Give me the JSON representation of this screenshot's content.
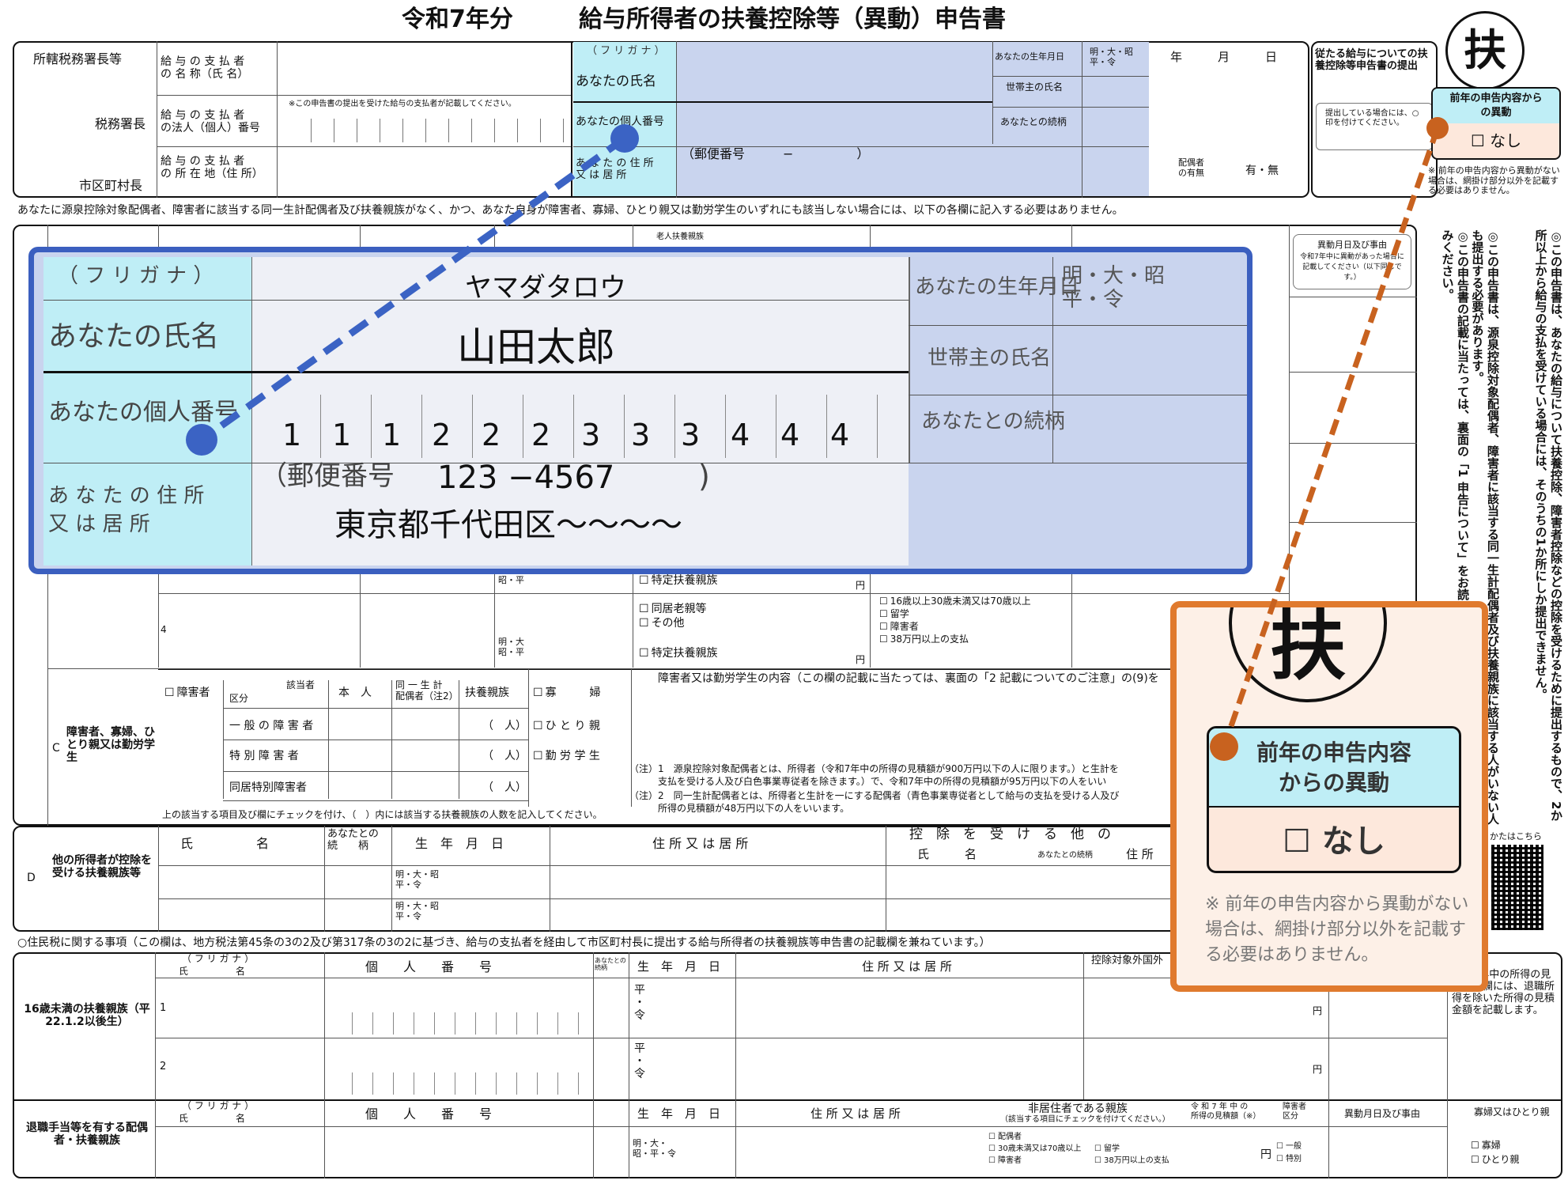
{
  "header": {
    "year": "令和7年分",
    "title": "給与所得者の扶養控除等（異動）申告書",
    "fu_badge": "扶"
  },
  "top": {
    "office_label1": "所轄税務署長等",
    "office_label2": "税務署長",
    "office_label3": "市区町村長",
    "payer_name": "給 与 の 支 払 者\nの 名 称（氏 名）",
    "payer_number": "給 与 の 支 払 者\nの法人（個人）番号",
    "payer_number_note": "※この申告書の提出を受けた給与の支払者が記載してください。",
    "payer_address": "給 与 の 支 払 者\nの 所 在 地（住 所）",
    "furigana_small": "（ フ リ ガ ナ ）",
    "name_small": "あなたの氏名",
    "mynumber_small": "あなたの個人番号",
    "address_small": "あ な た の 住 所\n又 は 居 所",
    "postal_small": "（郵便番号　　　−　　　　　）",
    "birth_small": "あなたの生年月日",
    "era_small": "明・大・昭\n平・令",
    "ymd": "年　　　月　　　日",
    "head_small": "世帯主の氏名",
    "relation_small": "あなたとの続柄",
    "spouse_small": "配偶者\nの有無",
    "spouse_yn": "有・無",
    "side_box_title": "従たる給与についての扶養控除等申告書の提出",
    "side_box_note": "提出している場合には、○印を付けてください。",
    "change_title": "前年の申告内容からの異動",
    "change_none": "なし",
    "change_note": "※ 前年の申告内容から異動がない場合は、網掛け部分以外を記載する必要はありません。"
  },
  "notice_line": "あなたに源泉控除対象配偶者、障害者に該当する同一生計配偶者及び扶養親族がなく、かつ、あなた自身が障害者、寡婦、ひとり親又は勤労学生のいずれにも該当しない場合には、以下の各欄に記入する必要はありません。",
  "zoom_blue": {
    "furigana_label": "（ フ リ ガ ナ ）",
    "furigana_value": "ヤマダタロウ",
    "name_label": "あなたの氏名",
    "name_value": "山田太郎",
    "mynumber_label": "あなたの個人番号",
    "mynumber_digits": [
      "1",
      "1",
      "1",
      "2",
      "2",
      "2",
      "3",
      "3",
      "3",
      "4",
      "4",
      "4"
    ],
    "address_label": "あ な た の 住 所\n又 は 居 所",
    "postal_prefix": "（郵便番号",
    "postal_value": "123 −4567",
    "postal_suffix": ")",
    "address_value": "東京都千代田区～～～～",
    "birth_label": "あなたの生年月日",
    "era": "明・大・昭\n平・令",
    "head_label": "世帯主の氏名",
    "relation_label": "あなたとの続柄"
  },
  "zoom_orange": {
    "badge": "扶",
    "title": "前年の申告内容\nからの異動",
    "none": "なし",
    "note": "※ 前年の申告内容から異動がない場合は、網掛け部分以外を記載する必要はありません。"
  },
  "middle": {
    "item_specific": "特定扶養親族",
    "item_elderly": "同居老親等",
    "item_other": "その他",
    "item_specific2": "特定扶養親族",
    "era_mt": "明・大\n昭・平",
    "era_sh": "昭・平",
    "row4": "4",
    "yen": "円",
    "checks_right": [
      "16歳以上30歳未満又は70歳以上",
      "留学",
      "障害者",
      "38万円以上の支払"
    ],
    "ryu_right_top": "異動月日及び事由",
    "ryu_right_note": "令和7年中に異動があった場合に記載してください（以下同じです。）",
    "old_dep": "老人扶養親族"
  },
  "section_c": {
    "label": "C",
    "heading": "障害者、寡婦、ひとり親又は勤労学生",
    "disabled": "障害者",
    "kubun": "区分",
    "gaitosha": "該当者",
    "honnin": "本　人",
    "same_spouse": "同 一 生 計\n配偶者（注2）",
    "dependents": "扶養親族",
    "rows": [
      "一 般 の 障 害 者",
      "特 別 障 害 者",
      "同居特別障害者"
    ],
    "people": "（　人）",
    "widow": "寡　　　婦",
    "single_parent": "ひ と り 親",
    "student": "勤 労 学 生",
    "content_title": "障害者又は勤労学生の内容（この欄の記載に当たっては、裏面の「2 記載についてのご注意」の(9)を",
    "note1": "（注）1　源泉控除対象配偶者とは、所得者（令和7年中の所得の見積額が900万円以下の人に限ります。）と生計を",
    "note1b": "支払を受ける人及び白色事業専従者を除きます。）で、令和7年中の所得の見積額が95万円以下の人をいい",
    "note2": "（注）2　同一生計配偶者とは、所得者と生計を一にする配偶者（青色事業専従者として給与の支払を受ける人及び",
    "note2b": "所得の見積額が48万円以下の人をいいます。",
    "footer": "上の該当する項目及び欄にチェックを付け、（　）内には該当する扶養親族の人数を記入してください。"
  },
  "section_d": {
    "label": "D",
    "heading": "他の所得者が控除を受ける扶養親族等",
    "name": "氏　　　　　名",
    "relation": "あなたとの\n続　　柄",
    "birth": "生　年　月　日",
    "address": "住 所 又 は 居 所",
    "deduct": "控　除　を　受　け　る　他　の",
    "d_name": "氏　　　名",
    "d_rel": "あなたとの続柄",
    "d_addr": "住 所",
    "era": "明・大・昭\n平・令",
    "qr_label": "かたはこちら"
  },
  "resident_line": "○住民税に関する事項（この欄は、地方税法第45条の3の2及び第317条の3の2に基づき、給与の支払者を経由して市区町村長に提出する給与所得者の扶養親族等申告書の記載欄を兼ねています。）",
  "section_res": {
    "under16": "16歳未満の扶養親族（平22.1.2以後生）",
    "furigana": "（ フ リ ガ ナ ）",
    "name": "氏　　　　　名",
    "mynumber": "個　　人　　番　　号",
    "rel_small": "あなたとの続柄",
    "birth": "生　年　月　日",
    "address": "住 所 又 は 居 所",
    "overseas": "控除対象外国外",
    "row1": "1",
    "row2": "2",
    "era_hr": "平\n・\n令",
    "yen": "円",
    "retire": "退職手当等を有する配偶者・扶養親族",
    "nonres": "非居住者である親族",
    "nonres_note": "（該当する項目にチェックを付けてください。）",
    "income_est": "令 和 7 年 中 の\n所得の見積額（※）",
    "dis_kubun": "障害者\n区分",
    "move": "異動月日及び事由",
    "widow_single": "寡婦又はひとり親",
    "checks": [
      "配偶者",
      "30歳未満又は70歳以上",
      "障害者",
      "留学",
      "38万円以上の支払"
    ],
    "general": "一般",
    "special": "特別",
    "widow": "寡婦",
    "single": "ひとり親",
    "era_all": "明・大・\n昭・平・令",
    "right_note": "令和7年中の所得の見積額」欄には、退職所得を除いた所得の見積金額を記載します。"
  },
  "right_column": {
    "col1": "◎この申告書は、あなたの給与について扶養控除、障害者控除などの控除を受けるために提出するもので、2か所以上から給与の支払を受けている場合には、そのうちの1か所にしか提出できません。",
    "col2": "◎この申告書は、源泉控除対象配偶者、障害者に該当する同一生計配偶者及び扶養親族に該当する人がいない人も提出する必要があります。",
    "col3": "◎この申告書の記載に当たっては、裏面の「1 申告について」をお読みください。"
  },
  "colors": {
    "blue_fill": "#c9d4ee",
    "cyan_fill": "#bfeef6",
    "blue_frame": "#3b5fbf",
    "orange_frame": "#e07a2e",
    "dot_blue": "#3b63c4",
    "dot_orange": "#c8621f"
  }
}
